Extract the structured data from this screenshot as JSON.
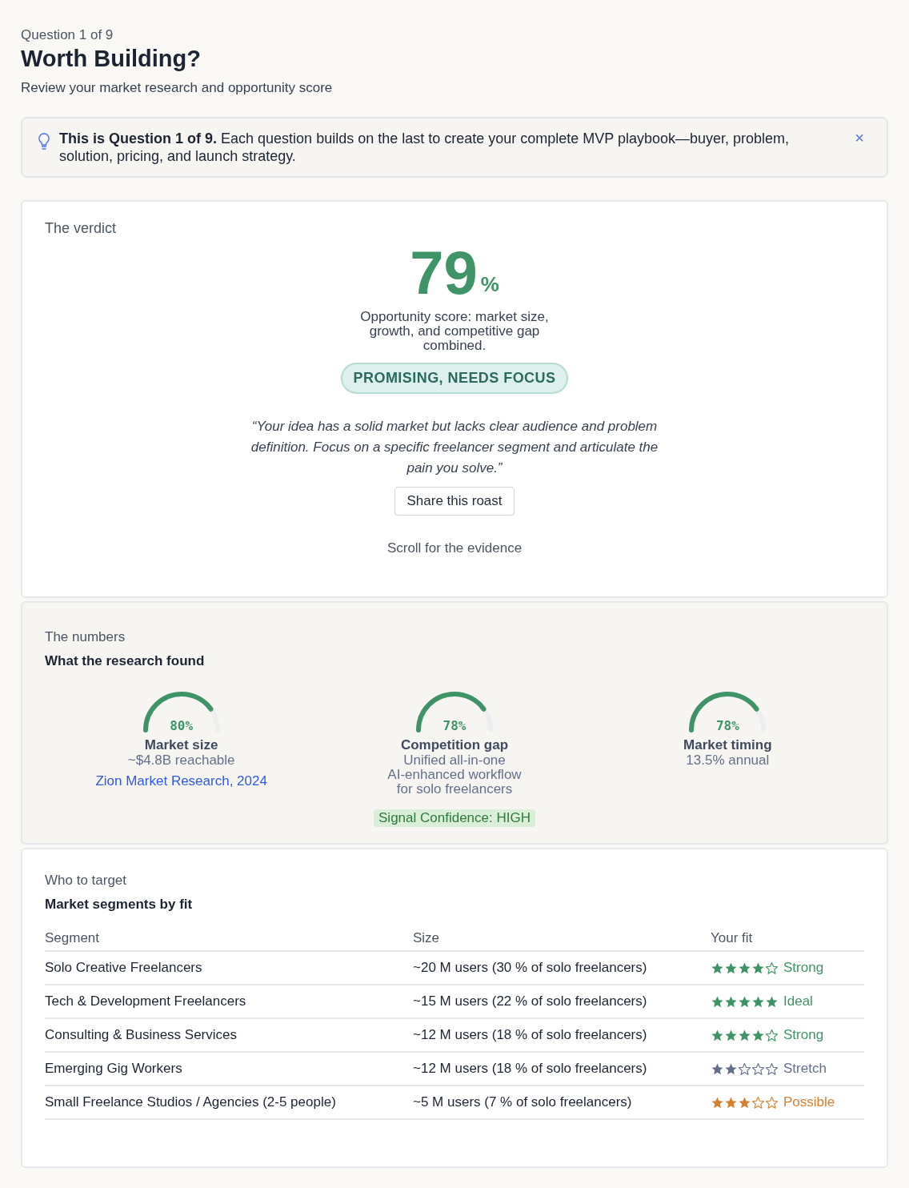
{
  "header": {
    "step": "Question 1 of 9",
    "title": "Worth Building?",
    "subtitle": "Review your market research and opportunity score"
  },
  "notice": {
    "text": "**This is Question 1 of 9.** Each question builds on the last to create your complete MVP playbook—buyer, problem, solution, pricing, and launch strategy.",
    "dismiss": "×"
  },
  "verdict": {
    "label": "The verdict",
    "score": "79",
    "unit": "%",
    "caption": "Opportunity score: market size, growth, and competitive gap combined.",
    "badge": "PROMISING, NEEDS FOCUS",
    "quote": "“Your idea has a solid market but lacks clear audience and problem definition. Focus on a specific freelancer segment and articulate the pain you solve.”",
    "share_button": "Share this roast",
    "scroll_hint": "Scroll for the evidence"
  },
  "numbers": {
    "label": "The numbers",
    "title": "What the research found",
    "metrics": [
      {
        "reading": "80%",
        "name": "Market size",
        "detail": [
          "~$4.8B reachable"
        ],
        "source": "Zion Market Research, 2024"
      },
      {
        "reading": "78%",
        "name": "Competition gap",
        "detail": [
          "Unified all-in-one",
          "AI-enhanced workflow",
          "for solo freelancers"
        ],
        "tag": "Signal Confidence: HIGH"
      },
      {
        "reading": "78%",
        "name": "Market timing",
        "detail": [
          "13.5% annual"
        ]
      }
    ]
  },
  "segments": {
    "label": "Who to target",
    "title": "Market segments by fit",
    "columns": [
      "Segment",
      "Size",
      "Your fit"
    ],
    "rows": [
      {
        "segment": "Solo Creative Freelancers",
        "size": "~20 M users (30 % of solo freelancers)",
        "stars": 4,
        "fit": "Strong",
        "color": "#3f9467"
      },
      {
        "segment": "Tech & Development Freelancers",
        "size": "~15 M users (22 % of solo freelancers)",
        "stars": 5,
        "fit": "Ideal",
        "color": "#3f9467"
      },
      {
        "segment": "Consulting & Business Services",
        "size": "~12 M users (18 % of solo freelancers)",
        "stars": 4,
        "fit": "Strong",
        "color": "#3f9467"
      },
      {
        "segment": "Emerging Gig Workers",
        "size": "~12 M users (18 % of solo freelancers)",
        "stars": 2,
        "fit": "Stretch",
        "color": "#64708a"
      },
      {
        "segment": "Small Freelance Studios / Agencies (2-5 people)",
        "size": "~5 M users (7 % of solo freelancers)",
        "stars": 3,
        "fit": "Possible",
        "color": "#d5802e"
      }
    ]
  }
}
